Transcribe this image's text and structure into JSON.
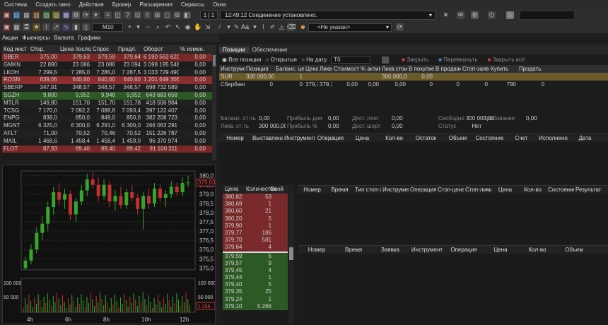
{
  "menu": [
    "Система",
    "Создать окно",
    "Действия",
    "Брокер",
    "Расширения",
    "Сервисы",
    "Окна"
  ],
  "toolbar": {
    "page": "1 | 1",
    "status": "12:49:12 Соединение установлено.",
    "timeframe": "M10",
    "font": "Aa",
    "account": "<Не указан>"
  },
  "tabs": [
    "Акции",
    "Фьючерсы",
    "Валюта",
    "Графики"
  ],
  "quotes": {
    "headers": [
      "Код инст",
      "Откр.",
      "Цена послед",
      "Спрос",
      "Предл.",
      "Оборот",
      "% измен."
    ],
    "rows": [
      {
        "c": [
          "SBER",
          "375,00",
          "379,63",
          "379,59",
          "379,64",
          "6 190 563 620",
          "0,00"
        ],
        "hl": "red"
      },
      {
        "c": [
          "GMKN",
          "22 890",
          "23 086",
          "23 086",
          "23 094",
          "3 098 195 548",
          "0,00"
        ]
      },
      {
        "c": [
          "LKOH",
          "7 299,5",
          "7 285,0",
          "7 285,0",
          "7 287,5",
          "3 033 729 490",
          "0,00"
        ]
      },
      {
        "c": [
          "ROSN",
          "639,05",
          "640,60",
          "640,60",
          "640,60",
          "1 201 649 306",
          "0,00"
        ],
        "hl": "red2"
      },
      {
        "c": [
          "SBERP",
          "347,91",
          "348,57",
          "348,57",
          "348,57",
          "698 732 589",
          "0,00"
        ]
      },
      {
        "c": [
          "SGZH",
          "9,800",
          "9,952",
          "9,948",
          "9,952",
          "643 683 658",
          "0,00"
        ],
        "hl": "green"
      },
      {
        "c": [
          "MTLR",
          "149,80",
          "151,70",
          "151,70",
          "151,78",
          "418 506 984",
          "0,00"
        ]
      },
      {
        "c": [
          "TCSG",
          "7 170,0",
          "7 092,2",
          "7 088,8",
          "7 093,4",
          "397 122 407",
          "0,00"
        ]
      },
      {
        "c": [
          "ENPG",
          "838,0",
          "850,0",
          "849,0",
          "850,0",
          "382 208 723",
          "0,00"
        ]
      },
      {
        "c": [
          "MGNT",
          "6 325,0",
          "6 300,0",
          "6 291,0",
          "6 300,0",
          "266 063 291",
          "0,00"
        ]
      },
      {
        "c": [
          "AFLT",
          "71,00",
          "70,52",
          "70,46",
          "70,52",
          "151 226 787",
          "0,00"
        ]
      },
      {
        "c": [
          "MAIL",
          "1 468,6",
          "1 458,4",
          "1 458,4",
          "1 459,0",
          "96 370 974",
          "0,00"
        ]
      },
      {
        "c": [
          "FLOT",
          "87,93",
          "89,40",
          "89,40",
          "89,42",
          "91 100 311",
          "0,00"
        ],
        "hl": "red"
      }
    ]
  },
  "chart": {
    "yticks": [
      "380,0",
      "379,5",
      "379,0",
      "378,5",
      "378,0",
      "377,5",
      "377,0",
      "376,5",
      "376,0",
      "375,5",
      "375,0"
    ],
    "last": "379,63",
    "vol_ticks": [
      "100 000",
      "50 000"
    ],
    "vol_last": "1 256",
    "xticks": [
      "4h",
      "6h",
      "8h",
      "10h",
      "12h"
    ],
    "ohlc": [
      [
        375.0,
        375.6,
        374.9,
        375.4
      ],
      [
        375.4,
        376.3,
        375.2,
        376.0
      ],
      [
        376.0,
        377.2,
        375.8,
        376.9
      ],
      [
        376.9,
        377.8,
        376.5,
        377.4
      ],
      [
        377.4,
        378.6,
        377.0,
        378.3
      ],
      [
        378.3,
        379.4,
        377.9,
        379.1
      ],
      [
        379.1,
        379.6,
        378.4,
        378.7
      ],
      [
        378.7,
        379.3,
        378.2,
        379.0
      ],
      [
        379.0,
        379.2,
        377.6,
        377.9
      ],
      [
        377.9,
        378.8,
        377.5,
        378.6
      ],
      [
        378.6,
        379.5,
        378.4,
        379.2
      ],
      [
        379.2,
        380.1,
        378.9,
        379.8
      ],
      [
        379.8,
        380.2,
        379.3,
        379.5
      ],
      [
        379.5,
        379.9,
        378.6,
        378.9
      ],
      [
        378.9,
        379.8,
        378.7,
        379.5
      ],
      [
        379.5,
        379.7,
        378.3,
        378.6
      ],
      [
        378.6,
        379.2,
        378.1,
        378.9
      ],
      [
        378.9,
        379.4,
        378.2,
        378.4
      ],
      [
        378.4,
        379.3,
        378.2,
        379.1
      ],
      [
        379.1,
        379.5,
        378.6,
        378.8
      ],
      [
        378.8,
        379.0,
        377.9,
        378.2
      ],
      [
        378.2,
        379.1,
        377.1,
        378.9
      ],
      [
        378.9,
        379.3,
        378.2,
        378.5
      ],
      [
        378.5,
        379.6,
        378.3,
        379.3
      ],
      [
        379.3,
        379.5,
        378.6,
        378.8
      ],
      [
        378.8,
        379.2,
        378.3,
        379.0
      ],
      [
        379.0,
        379.7,
        378.8,
        379.4
      ],
      [
        379.4,
        379.6,
        378.9,
        379.1
      ],
      [
        379.1,
        379.9,
        378.9,
        379.6
      ],
      [
        379.6,
        380.0,
        379.4,
        379.63
      ]
    ]
  },
  "right": {
    "tabs": [
      "Позиции",
      "Обеспечение"
    ],
    "radio": [
      "Все позиции",
      "Открытые",
      "На дату"
    ],
    "date": "T0",
    "buttons": [
      "Закрыть",
      "Перевернуть",
      "Закрыть всё"
    ],
    "pos_headers": [
      "Инструмент",
      "Позиция",
      "Баланс. цена",
      "Цена",
      "Ликв.",
      "Стоимость",
      "% активов",
      "Ликв.стоим",
      "В покупке",
      "В продаже",
      "Стоп-заявки",
      "Купить",
      "Продать"
    ],
    "pos_rows": [
      [
        "SUR",
        "300 000,00",
        "1",
        "",
        "",
        "",
        "",
        "300 000,00",
        "0,00",
        "",
        "",
        "",
        ""
      ],
      [
        "Сбербанк",
        "0",
        "0",
        "379,7",
        "379,7",
        "0,00",
        "0,00",
        "0,00",
        "0",
        "0",
        "0",
        "790",
        "0"
      ]
    ],
    "summary": [
      [
        "Баланс. ст-ть",
        "0,00",
        "Прибыль дня",
        "0,00",
        "Дост. лонг",
        "0,00",
        "Требование",
        "0,00"
      ],
      [
        "Ликв. ст-ть",
        "300 000,00",
        "Прибыль %",
        "0,00",
        "Дост. шорт",
        "0,00",
        "",
        ""
      ]
    ],
    "free_lbl": "Свободно",
    "free": "300 000,00",
    "status_lbl": "Статус",
    "status": "Нет",
    "orders_headers": [
      "Номер",
      "Выставлена",
      "Инструмент",
      "Операция",
      "Цена",
      "Кол-во",
      "Остаток",
      "Объем",
      "Состояние",
      "Счет",
      "Исполнено",
      "Дата"
    ],
    "stop_headers": [
      "Номер",
      "Время",
      "Тип стоп-заявки",
      "Инструмент",
      "Операция",
      "Стоп-цена",
      "Стоп-лимит",
      "Цена",
      "Кол-во",
      "Состояние",
      "Результат"
    ],
    "deals_headers": [
      "Номер",
      "Время",
      "Заявка",
      "Инструмент",
      "Операция",
      "Цена",
      "Кол-во",
      "Объем"
    ]
  },
  "orderbook": {
    "headers": [
      "Цена",
      "Количество",
      "Свой"
    ],
    "asks": [
      [
        "380,82",
        "53"
      ],
      [
        "380,69",
        "1"
      ],
      [
        "380,60",
        "21"
      ],
      [
        "380,20",
        "5"
      ],
      [
        "379,90",
        "1"
      ],
      [
        "379,77",
        "186"
      ],
      [
        "379,70",
        "581"
      ],
      [
        "379,64",
        "4"
      ]
    ],
    "bids": [
      [
        "379,59",
        "5"
      ],
      [
        "379,57",
        "9"
      ],
      [
        "379,45",
        "4"
      ],
      [
        "379,44",
        "1"
      ],
      [
        "379,40",
        "5"
      ],
      [
        "379,35",
        "25"
      ],
      [
        "379,24",
        "1"
      ],
      [
        "379,10",
        "5 266"
      ]
    ]
  }
}
